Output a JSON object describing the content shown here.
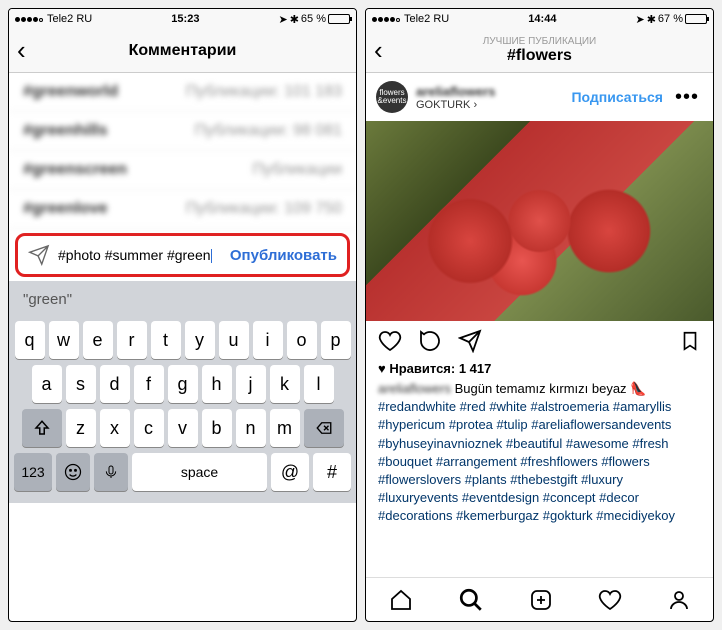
{
  "left": {
    "status": {
      "carrier": "Tele2 RU",
      "time": "15:23",
      "battery": "65 %"
    },
    "title": "Комментарии",
    "suggestions": [
      {
        "name": "#greenworld",
        "meta": "Публикации: 101 183"
      },
      {
        "name": "#greenhills",
        "meta": "Публикации: 98 081"
      },
      {
        "name": "#greenscreen",
        "meta": "Публикации"
      },
      {
        "name": "#greenlove",
        "meta": "Публикации: 109 750"
      }
    ],
    "comment_text": "#photo #summer #green",
    "publish": "Опубликовать",
    "autocomplete": "\"green\"",
    "kbd": {
      "row1": [
        "q",
        "w",
        "e",
        "r",
        "t",
        "y",
        "u",
        "i",
        "o",
        "p"
      ],
      "row2": [
        "a",
        "s",
        "d",
        "f",
        "g",
        "h",
        "j",
        "k",
        "l"
      ],
      "row3": [
        "z",
        "x",
        "c",
        "v",
        "b",
        "n",
        "m"
      ],
      "num": "123",
      "at": "@",
      "space": "space",
      "hash": "#"
    }
  },
  "right": {
    "status": {
      "carrier": "Tele2 RU",
      "time": "14:44",
      "battery": "67 %"
    },
    "subtitle": "ЛУЧШИЕ ПУБЛИКАЦИИ",
    "title": "#flowers",
    "avatar_text": "flowers &events",
    "username": "areliaflowers",
    "location": "GOKTURK ›",
    "follow": "Подписаться",
    "likes": "♥ Нравится: 1 417",
    "caption_lead": "Bugün temamız kırmızı beyaz",
    "hashtags": [
      "#redandwhite",
      "#red",
      "#white",
      "#alstroemeria",
      "#amaryllis",
      "#hypericum",
      "#protea",
      "#tulip",
      "#areliaflowersandevents",
      "#byhuseyinavnioznek",
      "#beautiful",
      "#awesome",
      "#fresh",
      "#bouquet",
      "#arrangement",
      "#freshflowers",
      "#flowers",
      "#flowerslovers",
      "#plants",
      "#thebestgift",
      "#luxury",
      "#luxuryevents",
      "#eventdesign",
      "#concept",
      "#decor",
      "#decorations",
      "#kemerburgaz",
      "#gokturk",
      "#mecidiyekoy"
    ]
  }
}
